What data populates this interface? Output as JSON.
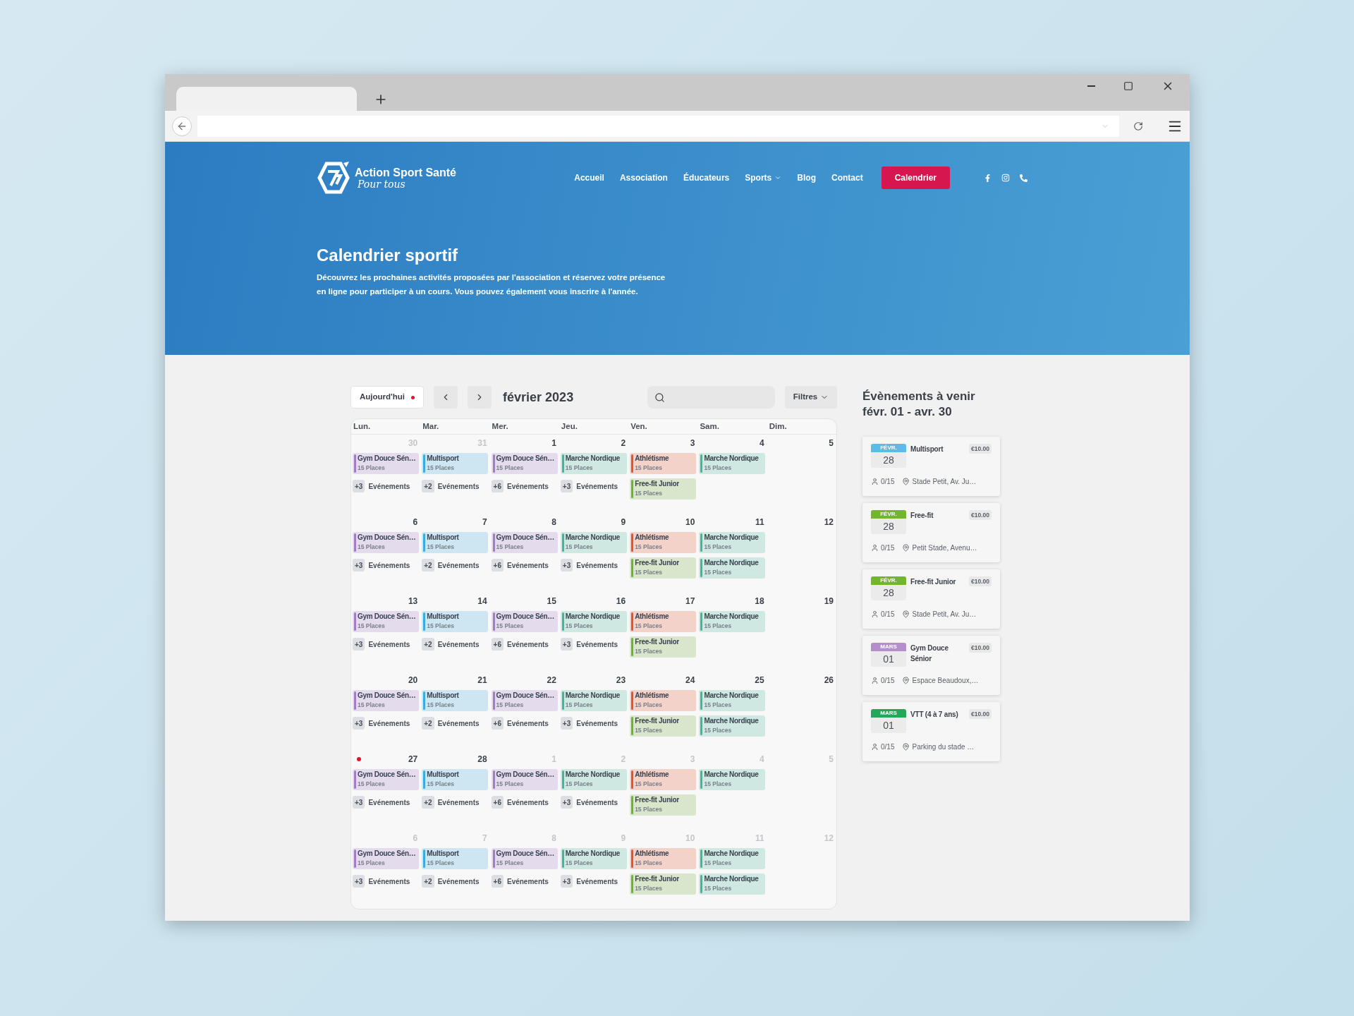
{
  "header": {
    "logo": {
      "name": "Action Sport Santé",
      "tagline": "Pour tous"
    },
    "nav": [
      {
        "label": "Accueil",
        "kind": "link"
      },
      {
        "label": "Association",
        "kind": "link"
      },
      {
        "label": "Éducateurs",
        "kind": "link"
      },
      {
        "label": "Sports",
        "kind": "dropdown"
      },
      {
        "label": "Blog",
        "kind": "link"
      },
      {
        "label": "Contact",
        "kind": "link"
      },
      {
        "label": "Calendrier",
        "kind": "button"
      }
    ]
  },
  "hero": {
    "title": "Calendrier sportif",
    "description": "Découvrez les prochaines activités proposées par l'association et réservez votre présence en ligne pour participer à un cours. Vous pouvez également vous inscrire à l'année."
  },
  "calendar": {
    "today_button": "Aujourd'hui",
    "month": "février 2023",
    "filters_button": "Filtres",
    "weekdays": [
      "Lun.",
      "Mar.",
      "Mer.",
      "Jeu.",
      "Ven.",
      "Sam.",
      "Dim."
    ],
    "weeks": [
      {
        "days": [
          {
            "number": "30",
            "in_month": false,
            "today": false,
            "events": [
              {
                "name": "Gym Douce Sén…",
                "places": "15 Places",
                "color": "#a47cc4"
              }
            ],
            "more": {
              "count": "+3",
              "label": "Evénements"
            }
          },
          {
            "number": "31",
            "in_month": false,
            "today": false,
            "events": [
              {
                "name": "Multisport",
                "places": "15 Places",
                "color": "#3cabde"
              }
            ],
            "more": {
              "count": "+2",
              "label": "Evénements"
            }
          },
          {
            "number": "1",
            "in_month": true,
            "today": false,
            "events": [
              {
                "name": "Gym Douce Sén…",
                "places": "15 Places",
                "color": "#a47cc4"
              }
            ],
            "more": {
              "count": "+6",
              "label": "Evénements"
            }
          },
          {
            "number": "2",
            "in_month": true,
            "today": false,
            "events": [
              {
                "name": "Marche Nordique",
                "places": "15 Places",
                "color": "#46b69a"
              }
            ],
            "more": {
              "count": "+3",
              "label": "Evénements"
            }
          },
          {
            "number": "3",
            "in_month": true,
            "today": false,
            "events": [
              {
                "name": "Athlétisme",
                "places": "15 Places",
                "color": "#e5532c"
              },
              {
                "name": "Free-fit Junior",
                "places": "15 Places",
                "color": "#6cb234"
              }
            ]
          },
          {
            "number": "4",
            "in_month": true,
            "today": false,
            "events": [
              {
                "name": "Marche Nordique",
                "places": "15 Places",
                "color": "#46b69a"
              }
            ]
          },
          {
            "number": "5",
            "in_month": true,
            "today": false
          }
        ]
      },
      {
        "days": [
          {
            "number": "6",
            "in_month": true,
            "today": false,
            "events": [
              {
                "name": "Gym Douce Sén…",
                "places": "15 Places",
                "color": "#a47cc4"
              }
            ],
            "more": {
              "count": "+3",
              "label": "Evénements"
            }
          },
          {
            "number": "7",
            "in_month": true,
            "today": false,
            "events": [
              {
                "name": "Multisport",
                "places": "15 Places",
                "color": "#3cabde"
              }
            ],
            "more": {
              "count": "+2",
              "label": "Evénements"
            }
          },
          {
            "number": "8",
            "in_month": true,
            "today": false,
            "events": [
              {
                "name": "Gym Douce Sén…",
                "places": "15 Places",
                "color": "#a47cc4"
              }
            ],
            "more": {
              "count": "+6",
              "label": "Evénements"
            }
          },
          {
            "number": "9",
            "in_month": true,
            "today": false,
            "events": [
              {
                "name": "Marche Nordique",
                "places": "15 Places",
                "color": "#46b69a"
              }
            ],
            "more": {
              "count": "+3",
              "label": "Evénements"
            }
          },
          {
            "number": "10",
            "in_month": true,
            "today": false,
            "events": [
              {
                "name": "Athlétisme",
                "places": "15 Places",
                "color": "#e5532c"
              },
              {
                "name": "Free-fit Junior",
                "places": "15 Places",
                "color": "#6cb234"
              }
            ]
          },
          {
            "number": "11",
            "in_month": true,
            "today": false,
            "events": [
              {
                "name": "Marche Nordique",
                "places": "15 Places",
                "color": "#46b69a"
              },
              {
                "name": "Marche Nordique",
                "places": "15 Places",
                "color": "#46b69a"
              }
            ]
          },
          {
            "number": "12",
            "in_month": true,
            "today": false
          }
        ]
      },
      {
        "days": [
          {
            "number": "13",
            "in_month": true,
            "today": false,
            "events": [
              {
                "name": "Gym Douce Sén…",
                "places": "15 Places",
                "color": "#a47cc4"
              }
            ],
            "more": {
              "count": "+3",
              "label": "Evénements"
            }
          },
          {
            "number": "14",
            "in_month": true,
            "today": false,
            "events": [
              {
                "name": "Multisport",
                "places": "15 Places",
                "color": "#3cabde"
              }
            ],
            "more": {
              "count": "+2",
              "label": "Evénements"
            }
          },
          {
            "number": "15",
            "in_month": true,
            "today": false,
            "events": [
              {
                "name": "Gym Douce Sén…",
                "places": "15 Places",
                "color": "#a47cc4"
              }
            ],
            "more": {
              "count": "+6",
              "label": "Evénements"
            }
          },
          {
            "number": "16",
            "in_month": true,
            "today": false,
            "events": [
              {
                "name": "Marche Nordique",
                "places": "15 Places",
                "color": "#46b69a"
              }
            ],
            "more": {
              "count": "+3",
              "label": "Evénements"
            }
          },
          {
            "number": "17",
            "in_month": true,
            "today": false,
            "events": [
              {
                "name": "Athlétisme",
                "places": "15 Places",
                "color": "#e5532c"
              },
              {
                "name": "Free-fit Junior",
                "places": "15 Places",
                "color": "#6cb234"
              }
            ]
          },
          {
            "number": "18",
            "in_month": true,
            "today": false,
            "events": [
              {
                "name": "Marche Nordique",
                "places": "15 Places",
                "color": "#46b69a"
              }
            ]
          },
          {
            "number": "19",
            "in_month": true,
            "today": false
          }
        ]
      },
      {
        "days": [
          {
            "number": "20",
            "in_month": true,
            "today": false,
            "events": [
              {
                "name": "Gym Douce Sén…",
                "places": "15 Places",
                "color": "#a47cc4"
              }
            ],
            "more": {
              "count": "+3",
              "label": "Evénements"
            }
          },
          {
            "number": "21",
            "in_month": true,
            "today": false,
            "events": [
              {
                "name": "Multisport",
                "places": "15 Places",
                "color": "#3cabde"
              }
            ],
            "more": {
              "count": "+2",
              "label": "Evénements"
            }
          },
          {
            "number": "22",
            "in_month": true,
            "today": false,
            "events": [
              {
                "name": "Gym Douce Sén…",
                "places": "15 Places",
                "color": "#a47cc4"
              }
            ],
            "more": {
              "count": "+6",
              "label": "Evénements"
            }
          },
          {
            "number": "23",
            "in_month": true,
            "today": false,
            "events": [
              {
                "name": "Marche Nordique",
                "places": "15 Places",
                "color": "#46b69a"
              }
            ],
            "more": {
              "count": "+3",
              "label": "Evénements"
            }
          },
          {
            "number": "24",
            "in_month": true,
            "today": false,
            "events": [
              {
                "name": "Athlétisme",
                "places": "15 Places",
                "color": "#e5532c"
              },
              {
                "name": "Free-fit Junior",
                "places": "15 Places",
                "color": "#6cb234"
              }
            ]
          },
          {
            "number": "25",
            "in_month": true,
            "today": false,
            "events": [
              {
                "name": "Marche Nordique",
                "places": "15 Places",
                "color": "#46b69a"
              },
              {
                "name": "Marche Nordique",
                "places": "15 Places",
                "color": "#46b69a"
              }
            ]
          },
          {
            "number": "26",
            "in_month": true,
            "today": false
          }
        ]
      },
      {
        "days": [
          {
            "number": "27",
            "in_month": true,
            "today": true,
            "events": [
              {
                "name": "Gym Douce Sén…",
                "places": "15 Places",
                "color": "#a47cc4"
              }
            ],
            "more": {
              "count": "+3",
              "label": "Evénements"
            }
          },
          {
            "number": "28",
            "in_month": true,
            "today": false,
            "events": [
              {
                "name": "Multisport",
                "places": "15 Places",
                "color": "#3cabde"
              }
            ],
            "more": {
              "count": "+2",
              "label": "Evénements"
            }
          },
          {
            "number": "1",
            "in_month": false,
            "today": false,
            "events": [
              {
                "name": "Gym Douce Sén…",
                "places": "15 Places",
                "color": "#a47cc4"
              }
            ],
            "more": {
              "count": "+6",
              "label": "Evénements"
            }
          },
          {
            "number": "2",
            "in_month": false,
            "today": false,
            "events": [
              {
                "name": "Marche Nordique",
                "places": "15 Places",
                "color": "#46b69a"
              }
            ],
            "more": {
              "count": "+3",
              "label": "Evénements"
            }
          },
          {
            "number": "3",
            "in_month": false,
            "today": false,
            "events": [
              {
                "name": "Athlétisme",
                "places": "15 Places",
                "color": "#e5532c"
              },
              {
                "name": "Free-fit Junior",
                "places": "15 Places",
                "color": "#6cb234"
              }
            ]
          },
          {
            "number": "4",
            "in_month": false,
            "today": false,
            "events": [
              {
                "name": "Marche Nordique",
                "places": "15 Places",
                "color": "#46b69a"
              }
            ]
          },
          {
            "number": "5",
            "in_month": false,
            "today": false
          }
        ]
      },
      {
        "days": [
          {
            "number": "6",
            "in_month": false,
            "today": false,
            "events": [
              {
                "name": "Gym Douce Sén…",
                "places": "15 Places",
                "color": "#a47cc4"
              }
            ],
            "more": {
              "count": "+3",
              "label": "Evénements"
            }
          },
          {
            "number": "7",
            "in_month": false,
            "today": false,
            "events": [
              {
                "name": "Multisport",
                "places": "15 Places",
                "color": "#3cabde"
              }
            ],
            "more": {
              "count": "+2",
              "label": "Evénements"
            }
          },
          {
            "number": "8",
            "in_month": false,
            "today": false,
            "events": [
              {
                "name": "Gym Douce Sén…",
                "places": "15 Places",
                "color": "#a47cc4"
              }
            ],
            "more": {
              "count": "+6",
              "label": "Evénements"
            }
          },
          {
            "number": "9",
            "in_month": false,
            "today": false,
            "events": [
              {
                "name": "Marche Nordique",
                "places": "15 Places",
                "color": "#46b69a"
              }
            ],
            "more": {
              "count": "+3",
              "label": "Evénements"
            }
          },
          {
            "number": "10",
            "in_month": false,
            "today": false,
            "events": [
              {
                "name": "Athlétisme",
                "places": "15 Places",
                "color": "#e5532c"
              },
              {
                "name": "Free-fit Junior",
                "places": "15 Places",
                "color": "#6cb234"
              }
            ]
          },
          {
            "number": "11",
            "in_month": false,
            "today": false,
            "events": [
              {
                "name": "Marche Nordique",
                "places": "15 Places",
                "color": "#46b69a"
              },
              {
                "name": "Marche Nordique",
                "places": "15 Places",
                "color": "#46b69a"
              }
            ]
          },
          {
            "number": "12",
            "in_month": false,
            "today": false
          }
        ]
      }
    ]
  },
  "upcoming": {
    "title": "Évènements à venir",
    "range": "févr. 01 - avr. 30",
    "events": [
      {
        "month": "FÉVR.",
        "day": "28",
        "color": "#5bbce8",
        "title": "Multisport",
        "price": "€10.00",
        "attendance": "0/15",
        "location": "Stade Petit, Av. Ju…"
      },
      {
        "month": "FÉVR.",
        "day": "28",
        "color": "#72b62e",
        "title": "Free-fit",
        "price": "€10.00",
        "attendance": "0/15",
        "location": "Petit Stade, Avenu…"
      },
      {
        "month": "FÉVR.",
        "day": "28",
        "color": "#72b62e",
        "title": "Free-fit Junior",
        "price": "€10.00",
        "attendance": "0/15",
        "location": "Stade Petit, Av. Ju…"
      },
      {
        "month": "MARS",
        "day": "01",
        "color": "#b58fcc",
        "title": "Gym Douce Sénior",
        "price": "€10.00",
        "attendance": "0/15",
        "location": "Espace Beaudoux,…"
      },
      {
        "month": "MARS",
        "day": "01",
        "color": "#23a85a",
        "title": "VTT (4 à 7 ans)",
        "price": "€10.00",
        "attendance": "0/15",
        "location": "Parking du stade …"
      }
    ]
  }
}
